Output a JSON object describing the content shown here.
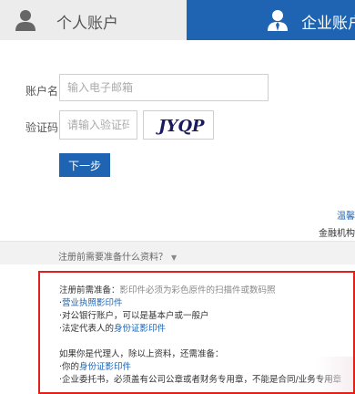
{
  "tabs": {
    "personal": {
      "label": "个人账户",
      "icon": "user-icon"
    },
    "enterprise": {
      "label": "企业账户",
      "icon": "business-user-icon"
    }
  },
  "form": {
    "account_label": "账户名",
    "account_placeholder": "输入电子邮箱",
    "captcha_label": "验证码",
    "captcha_placeholder": "请输入验证码",
    "captcha_text": "JYQP",
    "next_button": "下一步"
  },
  "side": {
    "link": "温馨",
    "text": "金融机构"
  },
  "requirements": {
    "toggle_label": "注册前需要准备什么资料？",
    "line1_prefix": "注册前需准备：",
    "line1_note": "影印件必须为彩色原件的扫描件或数码照",
    "item1_prefix": "·",
    "item1_link": "营业执照影印件",
    "item2": "·对公银行账户，可以是基本户或一般户",
    "item3_prefix": "·法定代表人的",
    "item3_link": "身份证影印件",
    "agent_title": "如果你是代理人，除以上资料，还需准备：",
    "item4_prefix": "·你的",
    "item4_link": "身份证影印件",
    "item5": "·企业委托书，必须盖有公司公章或者财务专用章，不能是合同/业务专用章"
  },
  "colors": {
    "brand_blue": "#1e64b3",
    "highlight_red": "#e0201b"
  }
}
